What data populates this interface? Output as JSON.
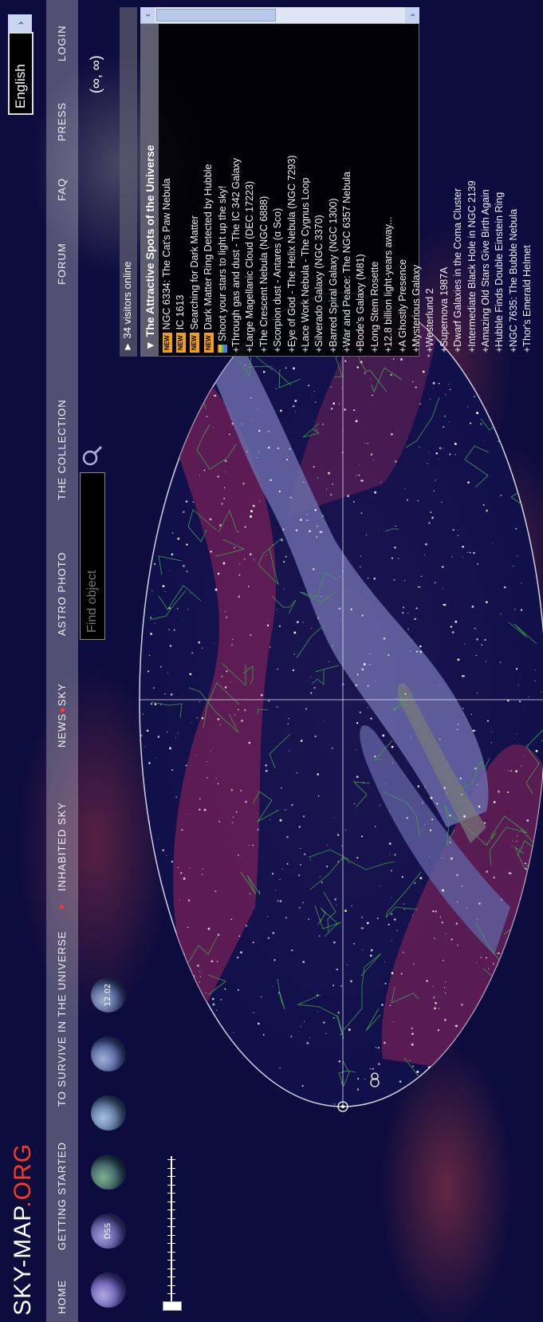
{
  "site": {
    "logo_main": "SKY-MAP",
    "logo_dot": ".ORG"
  },
  "nav": {
    "items": [
      "Home",
      "Getting Started",
      "To Survive in the Universe",
      "Inhabited Sky",
      "News",
      "Sky",
      "Astro Photo",
      "The Collection",
      "Forum",
      "FAQ",
      "Press",
      "Login"
    ],
    "news_sep": "●"
  },
  "language": {
    "selected": "English"
  },
  "toolbar": {
    "globes": [
      "",
      "DSS",
      "",
      "",
      "",
      "12.02"
    ],
    "find_placeholder": "Find object"
  },
  "coords": "(∞, ∞)",
  "visitors": "34 visitors online",
  "panel": {
    "title": "The Attractive Spots of the Universe",
    "items": [
      {
        "text": "NGC 6334: The Cat's Paw Nebula",
        "marker": "new"
      },
      {
        "text": "IC 1613",
        "marker": "new"
      },
      {
        "text": "Searching for Dark Matter",
        "marker": "new"
      },
      {
        "text": "Dark Matter Ring Detected by Hubble",
        "marker": "new"
      },
      {
        "text": "Shoot your stars to light up the sky!",
        "marker": "rainbow"
      },
      {
        "text": "Through gas and dust - The IC 342 Galaxy",
        "marker": "plus"
      },
      {
        "text": "Large Magellanic Cloud (DEC 17223)",
        "marker": "plus"
      },
      {
        "text": "The Crescent Nebula (NGC 6888)",
        "marker": "plus"
      },
      {
        "text": "Scorpion dust - Antares (α Sco)",
        "marker": "plus"
      },
      {
        "text": "Eye of God - The Helix Nebula (NGC 7293)",
        "marker": "plus"
      },
      {
        "text": "Lace Work Nebula - The Cygnus Loop",
        "marker": "plus"
      },
      {
        "text": "Silverado Galaxy (NGC 3370)",
        "marker": "plus"
      },
      {
        "text": "Barred Spiral Galaxy (NGC 1300)",
        "marker": "plus"
      },
      {
        "text": "War and Peace: The NGC 6357 Nebula",
        "marker": "plus"
      },
      {
        "text": "Bode's Galaxy (M81)",
        "marker": "plus"
      },
      {
        "text": "Long Stem Rosette",
        "marker": "plus"
      },
      {
        "text": "12.8 billion light-years away...",
        "marker": "plus"
      },
      {
        "text": "A Ghostly Presence",
        "marker": "plus"
      },
      {
        "text": "Mysterious Galaxy",
        "marker": "plus"
      },
      {
        "text": "Westerlund 2",
        "marker": "plus"
      },
      {
        "text": "Supernova 1987A",
        "marker": "plus"
      },
      {
        "text": "Dwarf Galaxies in the Coma Cluster",
        "marker": "plus"
      },
      {
        "text": "Intermediate Black Hole in NGC 2139",
        "marker": "plus"
      },
      {
        "text": "Amazing Old Stars Give Birth Again",
        "marker": "plus"
      },
      {
        "text": "Hubble Finds Double Einstein Ring",
        "marker": "plus"
      },
      {
        "text": "NGC 7635: The Bubble Nebula",
        "marker": "plus"
      },
      {
        "text": "Thor's Emerald Helmet",
        "marker": "plus"
      }
    ]
  },
  "colors": {
    "accent": "#ff3a20",
    "sky_background": "#0c0c3e",
    "milky_way": "#7a7aa8",
    "constellation_lines": "#3da04a",
    "badge": "#f0a020"
  }
}
